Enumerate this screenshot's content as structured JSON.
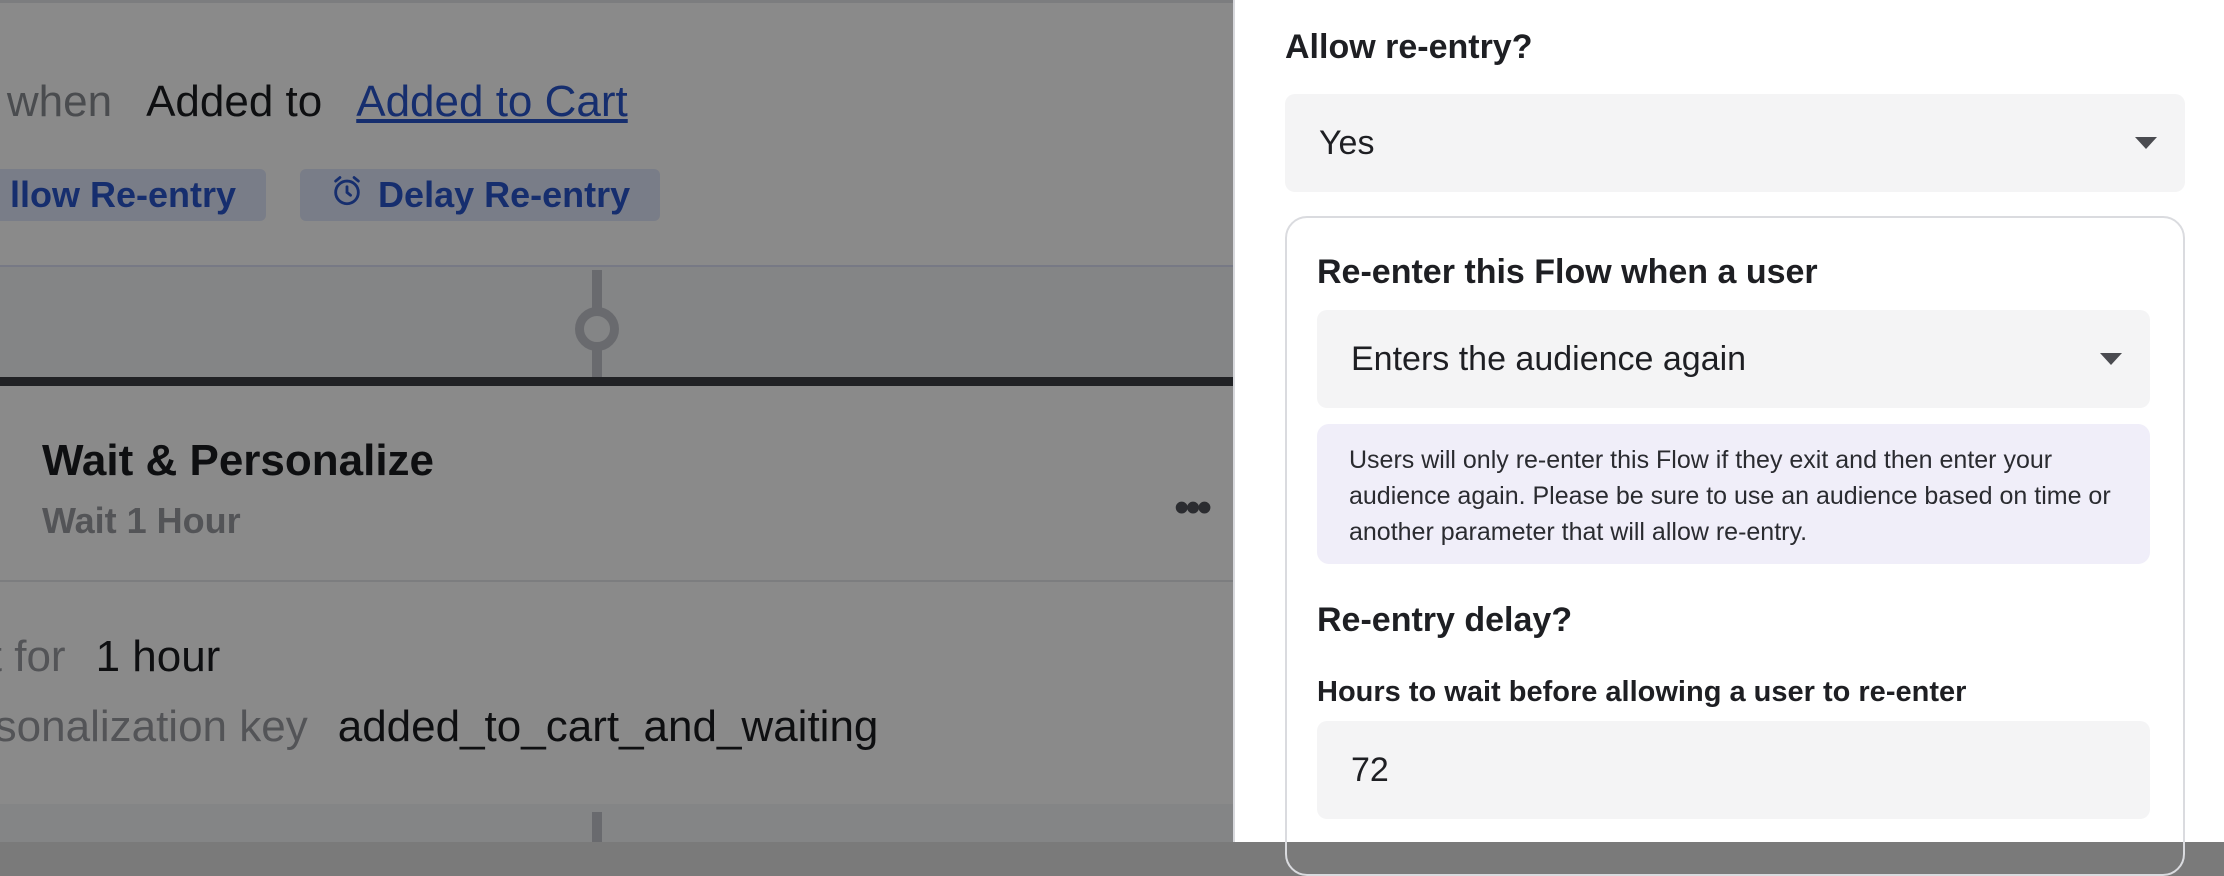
{
  "canvas": {
    "trigger": {
      "prefix": "r when",
      "event": "Added to",
      "target_link": "Added to Cart",
      "chips": [
        {
          "label": "llow Re-entry",
          "icon": "none"
        },
        {
          "label": "Delay Re-entry",
          "icon": "alarm-clock-icon"
        }
      ]
    },
    "wait_step": {
      "title": "Wait & Personalize",
      "subtitle": "Wait 1 Hour",
      "menu_icon": "more-horizontal-icon",
      "rows": [
        {
          "label": "it for",
          "value": "1 hour"
        },
        {
          "label": "rsonalization key",
          "value": "added_to_cart_and_waiting"
        }
      ]
    }
  },
  "panel": {
    "allow_reentry": {
      "label": "Allow re-entry?",
      "selected": "Yes"
    },
    "reenter_when": {
      "label": "Re-enter this Flow when a user",
      "selected": "Enters the audience again",
      "info": "Users will only re-enter this Flow if they exit and then enter your audience again. Please be sure to use an audience based on time or another parameter that will allow re-entry."
    },
    "delay": {
      "label": "Re-entry delay?",
      "hours_label": "Hours to wait before allowing a user to re-enter",
      "hours_value": "72"
    }
  },
  "colors": {
    "accent_blue": "#2a55cc",
    "chip_bg": "#dfe7fb",
    "info_bg": "#f0eef9",
    "overlay": "rgba(0,0,0,0.46)"
  }
}
